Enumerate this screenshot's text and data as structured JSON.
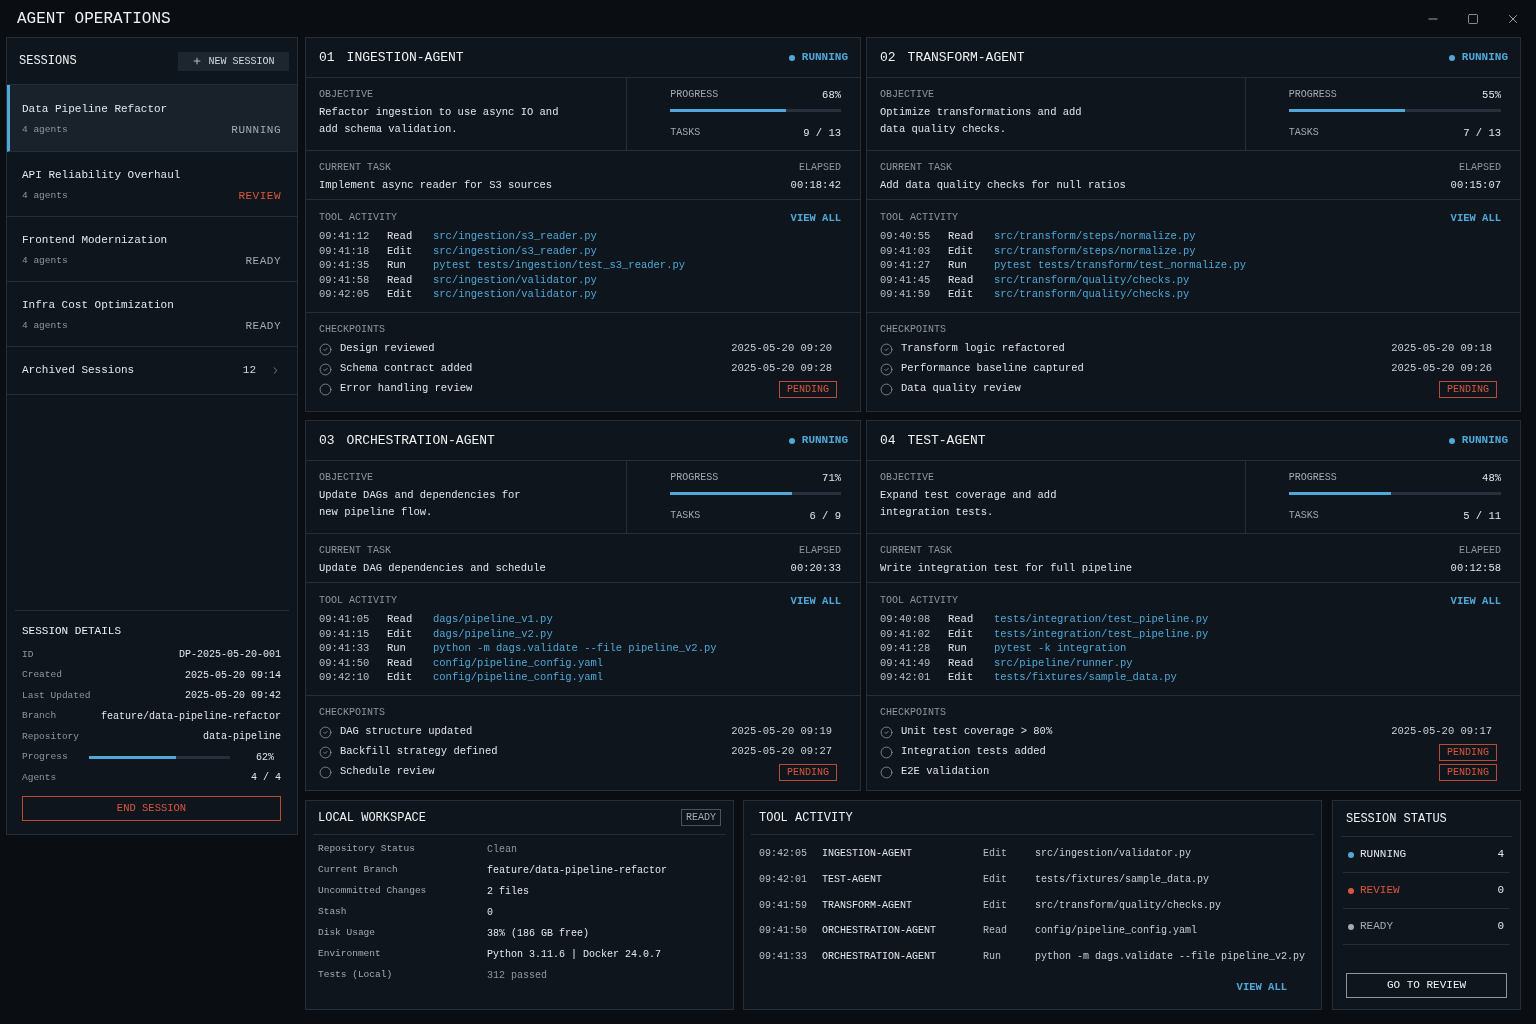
{
  "window": {
    "title": "AGENT OPERATIONS"
  },
  "sidebar": {
    "title": "SESSIONS",
    "new_session_button": "NEW SESSION",
    "sessions": [
      {
        "name": "Data Pipeline Refactor",
        "agents": "4 agents",
        "status": "RUNNING",
        "kind": "running",
        "selected": true
      },
      {
        "name": "API Reliability Overhaul",
        "agents": "4 agents",
        "status": "REVIEW",
        "kind": "review",
        "selected": false
      },
      {
        "name": "Frontend Modernization",
        "agents": "4 agents",
        "status": "READY",
        "kind": "ready",
        "selected": false
      },
      {
        "name": "Infra Cost Optimization",
        "agents": "4 agents",
        "status": "READY",
        "kind": "ready",
        "selected": false
      }
    ],
    "archived": {
      "label": "Archived Sessions",
      "count": "12"
    },
    "details": {
      "title": "SESSION DETAILS",
      "rows": [
        {
          "kind": "text",
          "label": "ID",
          "value": "DP-2025-05-20-001"
        },
        {
          "kind": "text",
          "label": "Created",
          "value": "2025-05-20 09:14"
        },
        {
          "kind": "text",
          "label": "Last Updated",
          "value": "2025-05-20 09:42"
        },
        {
          "kind": "text",
          "label": "Branch",
          "value": "feature/data-pipeline-refactor"
        },
        {
          "kind": "text",
          "label": "Repository",
          "value": "data-pipeline"
        },
        {
          "kind": "progress",
          "label": "Progress",
          "level": 0.62,
          "value": "62%"
        },
        {
          "kind": "text",
          "label": "Agents",
          "value": "4 / 4"
        }
      ],
      "end_button": "END SESSION"
    }
  },
  "agents": [
    {
      "number": "01",
      "name": "INGESTION-AGENT",
      "status": "RUNNING",
      "objective_label": "OBJECTIVE",
      "objective": "Refactor ingestion to use async IO and\nadd schema validation.",
      "progress_label": "PROGRESS",
      "progress": "68%",
      "level": 0.68,
      "tasks_label": "TASKS",
      "tasks": "9 / 13",
      "current_task_label": "CURRENT TASK",
      "current_task": "Implement async reader for S3 sources",
      "elapsed_label": "ELAPSED",
      "elapsed": "00:18:42",
      "activity_label": "TOOL ACTIVITY",
      "view_all": "VIEW ALL",
      "activity": [
        {
          "time": "09:41:12",
          "action": "Read",
          "target": "src/ingestion/s3_reader.py"
        },
        {
          "time": "09:41:18",
          "action": "Edit",
          "target": "src/ingestion/s3_reader.py"
        },
        {
          "time": "09:41:35",
          "action": "Run",
          "target": "pytest tests/ingestion/test_s3_reader.py"
        },
        {
          "time": "09:41:58",
          "action": "Read",
          "target": "src/ingestion/validator.py"
        },
        {
          "time": "09:42:05",
          "action": "Edit",
          "target": "src/ingestion/validator.py"
        }
      ],
      "checkpoints_label": "CHECKPOINTS",
      "checkpoints": [
        {
          "label": "Design reviewed",
          "checked": true,
          "timestamp": "2025-05-20 09:20"
        },
        {
          "label": "Schema contract added",
          "checked": true,
          "timestamp": "2025-05-20 09:28"
        },
        {
          "label": "Error handling review",
          "checked": false,
          "badge": "PENDING"
        }
      ]
    },
    {
      "number": "02",
      "name": "TRANSFORM-AGENT",
      "status": "RUNNING",
      "objective_label": "OBJECTIVE",
      "objective": "Optimize transformations and add\ndata quality checks.",
      "progress_label": "PROGRESS",
      "progress": "55%",
      "level": 0.55,
      "tasks_label": "TASKS",
      "tasks": "7 / 13",
      "current_task_label": "CURRENT TASK",
      "current_task": "Add data quality checks for null ratios",
      "elapsed_label": "ELAPSED",
      "elapsed": "00:15:07",
      "activity_label": "TOOL ACTIVITY",
      "view_all": "VIEW ALL",
      "activity": [
        {
          "time": "09:40:55",
          "action": "Read",
          "target": "src/transform/steps/normalize.py"
        },
        {
          "time": "09:41:03",
          "action": "Edit",
          "target": "src/transform/steps/normalize.py"
        },
        {
          "time": "09:41:27",
          "action": "Run",
          "target": "pytest tests/transform/test_normalize.py"
        },
        {
          "time": "09:41:45",
          "action": "Read",
          "target": "src/transform/quality/checks.py"
        },
        {
          "time": "09:41:59",
          "action": "Edit",
          "target": "src/transform/quality/checks.py"
        }
      ],
      "checkpoints_label": "CHECKPOINTS",
      "checkpoints": [
        {
          "label": "Transform logic refactored",
          "checked": true,
          "timestamp": "2025-05-20 09:18"
        },
        {
          "label": "Performance baseline captured",
          "checked": true,
          "timestamp": "2025-05-20 09:26"
        },
        {
          "label": "Data quality review",
          "checked": false,
          "badge": "PENDING"
        }
      ]
    },
    {
      "number": "03",
      "name": "ORCHESTRATION-AGENT",
      "status": "RUNNING",
      "objective_label": "OBJECTIVE",
      "objective": "Update DAGs and dependencies for\nnew pipeline flow.",
      "progress_label": "PROGRESS",
      "progress": "71%",
      "level": 0.71,
      "tasks_label": "TASKS",
      "tasks": "6 / 9",
      "current_task_label": "CURRENT TASK",
      "current_task": "Update DAG dependencies and schedule",
      "elapsed_label": "ELAPSED",
      "elapsed": "00:20:33",
      "activity_label": "TOOL ACTIVITY",
      "view_all": "VIEW ALL",
      "activity": [
        {
          "time": "09:41:05",
          "action": "Read",
          "target": "dags/pipeline_v1.py"
        },
        {
          "time": "09:41:15",
          "action": "Edit",
          "target": "dags/pipeline_v2.py"
        },
        {
          "time": "09:41:33",
          "action": "Run",
          "target": "python -m dags.validate --file pipeline_v2.py"
        },
        {
          "time": "09:41:50",
          "action": "Read",
          "target": "config/pipeline_config.yaml"
        },
        {
          "time": "09:42:10",
          "action": "Edit",
          "target": "config/pipeline_config.yaml"
        }
      ],
      "checkpoints_label": "CHECKPOINTS",
      "checkpoints": [
        {
          "label": "DAG structure updated",
          "checked": true,
          "timestamp": "2025-05-20 09:19"
        },
        {
          "label": "Backfill strategy defined",
          "checked": true,
          "timestamp": "2025-05-20 09:27"
        },
        {
          "label": "Schedule review",
          "checked": false,
          "badge": "PENDING"
        }
      ]
    },
    {
      "number": "04",
      "name": "TEST-AGENT",
      "status": "RUNNING",
      "objective_label": "OBJECTIVE",
      "objective": "Expand test coverage and add\nintegration tests.",
      "progress_label": "PROGRESS",
      "progress": "48%",
      "level": 0.48,
      "tasks_label": "TASKS",
      "tasks": "5 / 11",
      "current_task_label": "CURRENT TASK",
      "current_task": "Write integration test for full pipeline",
      "elapsed_label": "ELAPEED",
      "elapsed": "00:12:58",
      "activity_label": "TOOL ACTIVITY",
      "view_all": "VIEW ALL",
      "activity": [
        {
          "time": "09:40:08",
          "action": "Read",
          "target": "tests/integration/test_pipeline.py"
        },
        {
          "time": "09:41:02",
          "action": "Edit",
          "target": "tests/integration/test_pipeline.py"
        },
        {
          "time": "09:41:28",
          "action": "Run",
          "target": "pytest -k integration"
        },
        {
          "time": "09:41:49",
          "action": "Read",
          "target": "src/pipeline/runner.py"
        },
        {
          "time": "09:42:01",
          "action": "Edit",
          "target": "tests/fixtures/sample_data.py"
        }
      ],
      "checkpoints_label": "CHECKPOINTS",
      "checkpoints": [
        {
          "label": "Unit test coverage > 80%",
          "checked": true,
          "timestamp": "2025-05-20 09:17"
        },
        {
          "label": "Integration tests added",
          "checked": false,
          "badge": "PENDING"
        },
        {
          "label": "E2E validation",
          "checked": false,
          "badge": "PENDING"
        }
      ]
    }
  ],
  "workspace": {
    "title": "LOCAL WORKSPACE",
    "badge": "READY",
    "rows": [
      {
        "label": "Repository Status",
        "value": "Clean",
        "dim": true
      },
      {
        "label": "Current Branch",
        "value": "feature/data-pipeline-refactor",
        "dim": false
      },
      {
        "label": "Uncommitted Changes",
        "value": "2 files",
        "dim": false
      },
      {
        "label": "Stash",
        "value": "0",
        "dim": false
      },
      {
        "label": "Disk Usage",
        "value": "38% (186 GB free)",
        "dim": false
      },
      {
        "label": "Environment",
        "value": "Python 3.11.6 | Docker 24.0.7",
        "dim": false
      },
      {
        "label": "Tests (Local)",
        "value": "312 passed",
        "dim": true
      }
    ]
  },
  "tool_activity": {
    "title": "TOOL ACTIVITY",
    "rows": [
      {
        "time": "09:42:05",
        "agent": "INGESTION-AGENT",
        "action": "Edit",
        "target": "src/ingestion/validator.py"
      },
      {
        "time": "09:42:01",
        "agent": "TEST-AGENT",
        "action": "Edit",
        "target": "tests/fixtures/sample_data.py"
      },
      {
        "time": "09:41:59",
        "agent": "TRANSFORM-AGENT",
        "action": "Edit",
        "target": "src/transform/quality/checks.py"
      },
      {
        "time": "09:41:50",
        "agent": "ORCHESTRATION-AGENT",
        "action": "Read",
        "target": "config/pipeline_config.yaml"
      },
      {
        "time": "09:41:33",
        "agent": "ORCHESTRATION-AGENT",
        "action": "Run",
        "target": "python -m dags.validate --file pipeline_v2.py"
      }
    ],
    "view_all": "VIEW ALL"
  },
  "session_status": {
    "title": "SESSION STATUS",
    "items": [
      {
        "label": "RUNNING",
        "count": "4",
        "kind": "running",
        "color": "#4fa8d8"
      },
      {
        "label": "REVIEW",
        "count": "0",
        "kind": "review",
        "color": "#d9573f"
      },
      {
        "label": "READY",
        "count": "0",
        "kind": "ready",
        "color": "#a3aab2"
      }
    ],
    "button": "GO TO REVIEW"
  }
}
